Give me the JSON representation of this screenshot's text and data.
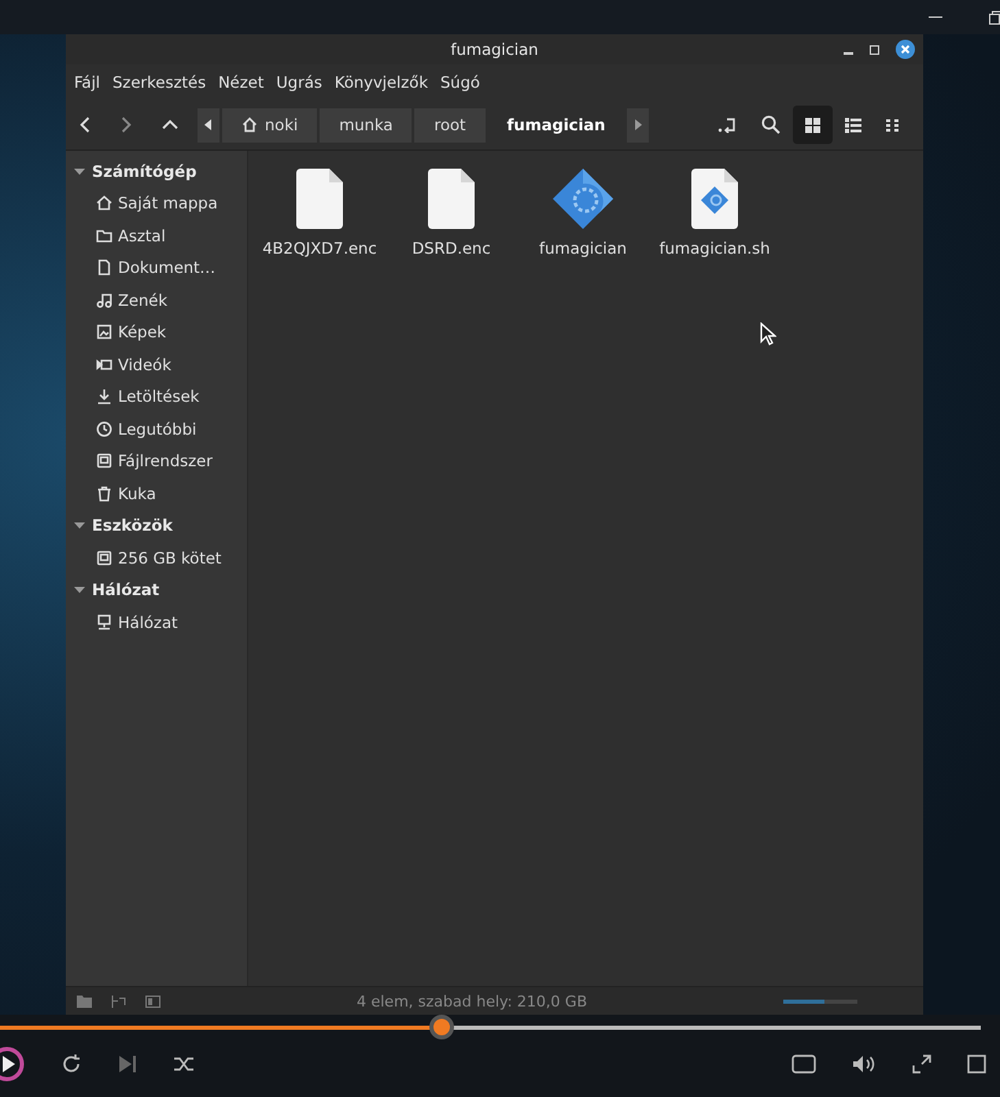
{
  "window": {
    "title": "fumagician"
  },
  "menu": [
    "Fájl",
    "Szerkesztés",
    "Nézet",
    "Ugrás",
    "Könyvjelzők",
    "Súgó"
  ],
  "breadcrumb": [
    {
      "label": "noki",
      "kind": "home",
      "selected": false
    },
    {
      "label": "munka",
      "kind": "plain",
      "selected": false
    },
    {
      "label": "root",
      "kind": "plain",
      "selected": false
    },
    {
      "label": "fumagician",
      "kind": "plain",
      "selected": true
    }
  ],
  "views": [
    {
      "kind": "grid",
      "selected": true
    },
    {
      "kind": "list",
      "selected": false
    },
    {
      "kind": "compact",
      "selected": false
    }
  ],
  "sidebar": [
    {
      "label": "Számítógép",
      "expanded": true,
      "children": [
        {
          "label": "Saját mappa",
          "kind": "home"
        },
        {
          "label": "Asztal",
          "kind": "folder"
        },
        {
          "label": "Dokument…",
          "kind": "document"
        },
        {
          "label": "Zenék",
          "kind": "music"
        },
        {
          "label": "Képek",
          "kind": "image"
        },
        {
          "label": "Videók",
          "kind": "video"
        },
        {
          "label": "Letöltések",
          "kind": "download"
        },
        {
          "label": "Legutóbbi",
          "kind": "clock"
        },
        {
          "label": "Fájlrendszer",
          "kind": "drive"
        },
        {
          "label": "Kuka",
          "kind": "trash"
        }
      ]
    },
    {
      "label": "Eszközök",
      "expanded": true,
      "children": [
        {
          "label": "256 GB kötet",
          "kind": "drive"
        }
      ]
    },
    {
      "label": "Hálózat",
      "expanded": true,
      "children": [
        {
          "label": "Hálózat",
          "kind": "network"
        }
      ]
    }
  ],
  "files": [
    {
      "name": "4B2QJXD7.enc",
      "kind": "blank"
    },
    {
      "name": "DSRD.enc",
      "kind": "blank"
    },
    {
      "name": "fumagician",
      "kind": "app"
    },
    {
      "name": "fumagician.sh",
      "kind": "script"
    }
  ],
  "status_bar": "4 elem, szabad hely: 210,0 GB",
  "zoom": {
    "level": 0.55
  },
  "player": {
    "level": 0.45
  }
}
